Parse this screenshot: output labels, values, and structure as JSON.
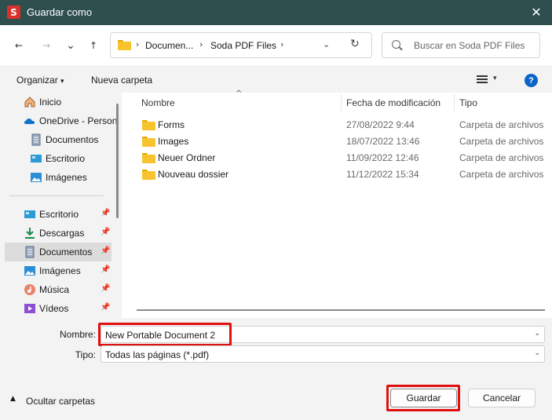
{
  "window": {
    "app_icon_letter": "S",
    "title": "Guardar como",
    "close_glyph": "✕"
  },
  "nav": {
    "back_glyph": "←",
    "forward_glyph": "→",
    "recent_glyph": "⌄",
    "up_glyph": "↑",
    "breadcrumb": [
      "Documen...",
      "Soda PDF Files"
    ],
    "separator": "›",
    "dropdown_glyph": "⌄",
    "refresh_glyph": "↻",
    "search_placeholder": "Buscar en Soda PDF Files"
  },
  "toolbar": {
    "organize_label": "Organizar",
    "organize_caret": "▾",
    "new_folder_label": "Nueva carpeta",
    "view_caret": "▾",
    "help_glyph": "?"
  },
  "sidebar": {
    "items": [
      {
        "label": "Inicio",
        "icon": "home-icon"
      },
      {
        "label": "OneDrive - Person",
        "icon": "onedrive-cloud-icon"
      },
      {
        "label": "Documentos",
        "icon": "documents-icon"
      },
      {
        "label": "Escritorio",
        "icon": "desktop-icon"
      },
      {
        "label": "Imágenes",
        "icon": "pictures-icon"
      }
    ],
    "quick_access": [
      {
        "label": "Escritorio",
        "icon": "desktop-icon",
        "pinned": true
      },
      {
        "label": "Descargas",
        "icon": "downloads-icon",
        "pinned": true
      },
      {
        "label": "Documentos",
        "icon": "documents-icon",
        "pinned": true,
        "selected": true
      },
      {
        "label": "Imágenes",
        "icon": "pictures-icon",
        "pinned": true
      },
      {
        "label": "Música",
        "icon": "music-icon",
        "pinned": true
      },
      {
        "label": "Vídeos",
        "icon": "videos-icon",
        "pinned": true
      }
    ],
    "pin_glyph": "📌"
  },
  "files": {
    "sort_caret": "^",
    "columns": {
      "name": "Nombre",
      "date": "Fecha de modificación",
      "type": "Tipo"
    },
    "rows": [
      {
        "name": "Forms",
        "date": "27/08/2022 9:44",
        "type": "Carpeta de archivos"
      },
      {
        "name": "Images",
        "date": "18/07/2022 13:46",
        "type": "Carpeta de archivos"
      },
      {
        "name": "Neuer Ordner",
        "date": "11/09/2022 12:46",
        "type": "Carpeta de archivos"
      },
      {
        "name": "Nouveau dossier",
        "date": "11/12/2022 15:34",
        "type": "Carpeta de archivos"
      }
    ]
  },
  "form": {
    "filename_label": "Nombre:",
    "filename_value": "New Portable Document 2",
    "filetype_label": "Tipo:",
    "filetype_value": "Todas las páginas (*.pdf)",
    "dropdown_glyph": "⌄"
  },
  "footer": {
    "hide_folders_caret": "▲",
    "hide_folders_label": "Ocultar carpetas",
    "save_label": "Guardar",
    "cancel_label": "Cancelar"
  },
  "colors": {
    "titlebar": "#2f4f4f",
    "app_icon": "#d9302c",
    "highlight_box": "#e01010",
    "folder": "#f7c32e",
    "help": "#0a64c8"
  }
}
